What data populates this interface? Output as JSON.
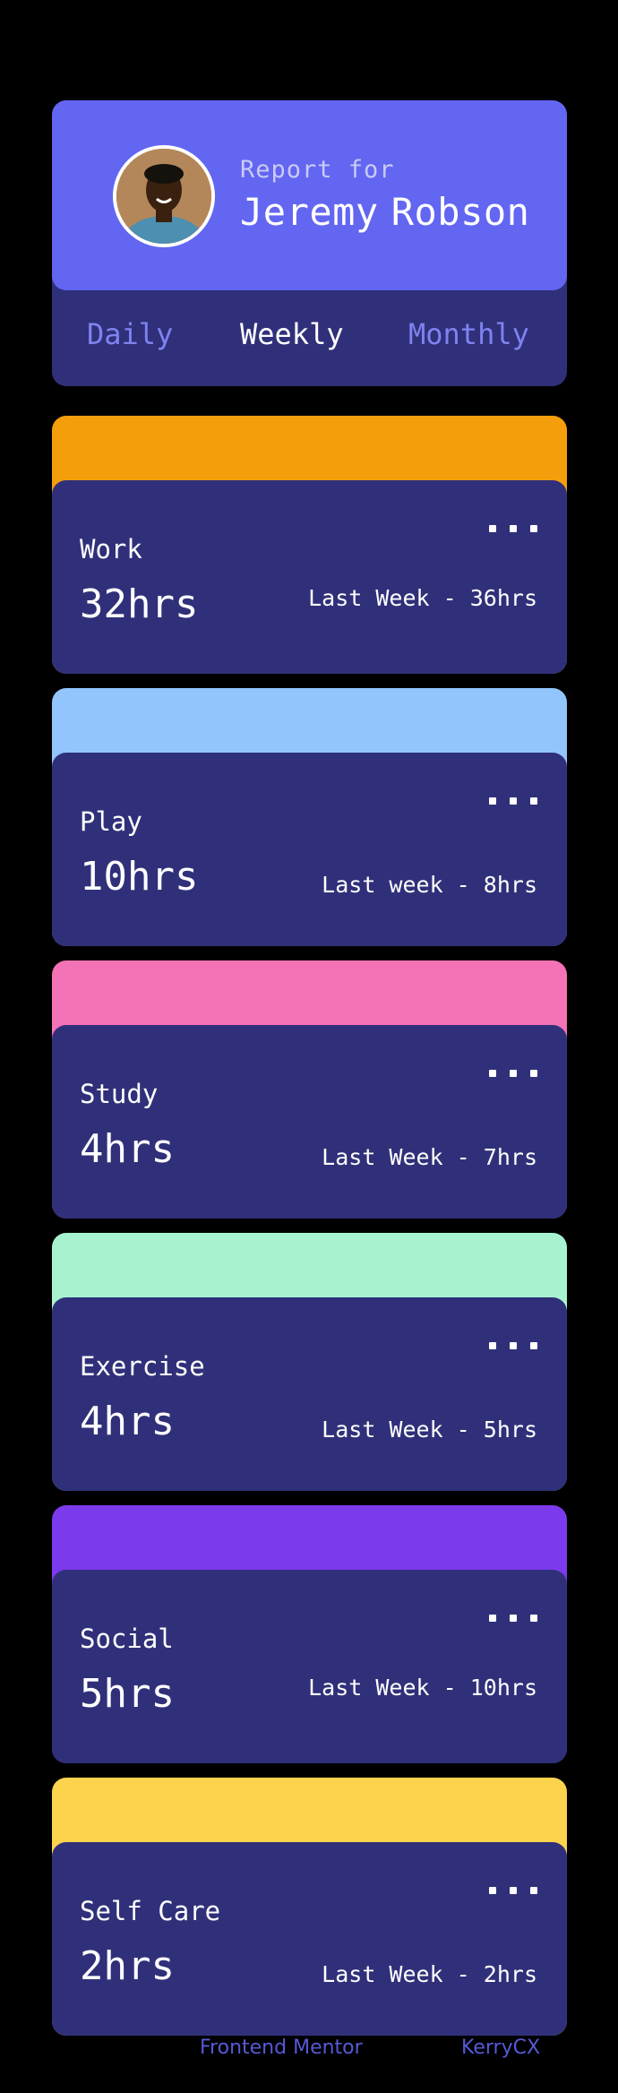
{
  "profile": {
    "report_for": "Report for",
    "first_name": "Jeremy",
    "last_name": "Robson",
    "tabs": [
      {
        "label": "Daily"
      },
      {
        "label": "Weekly"
      },
      {
        "label": "Monthly"
      }
    ],
    "active_tab": "Weekly"
  },
  "cards": [
    {
      "title": "Work",
      "current": "32hrs",
      "previous": "Last Week - 36hrs",
      "color": "#f59e0b"
    },
    {
      "title": "Play",
      "current": "10hrs",
      "previous": "Last week - 8hrs",
      "color": "#93c5fd"
    },
    {
      "title": "Study",
      "current": "4hrs",
      "previous": "Last Week - 7hrs",
      "color": "#f472b6"
    },
    {
      "title": "Exercise",
      "current": "4hrs",
      "previous": "Last Week - 5hrs",
      "color": "#a7f3d0"
    },
    {
      "title": "Social",
      "current": "5hrs",
      "previous": "Last Week - 10hrs",
      "color": "#7c3aed"
    },
    {
      "title": "Self Care",
      "current": "2hrs",
      "previous": "Last Week - 2hrs",
      "color": "#fcd34d"
    }
  ],
  "menu_icon": "ellipsis-icon",
  "footer": {
    "link_1": "Frontend Mentor",
    "link_2": "KerryCX"
  }
}
